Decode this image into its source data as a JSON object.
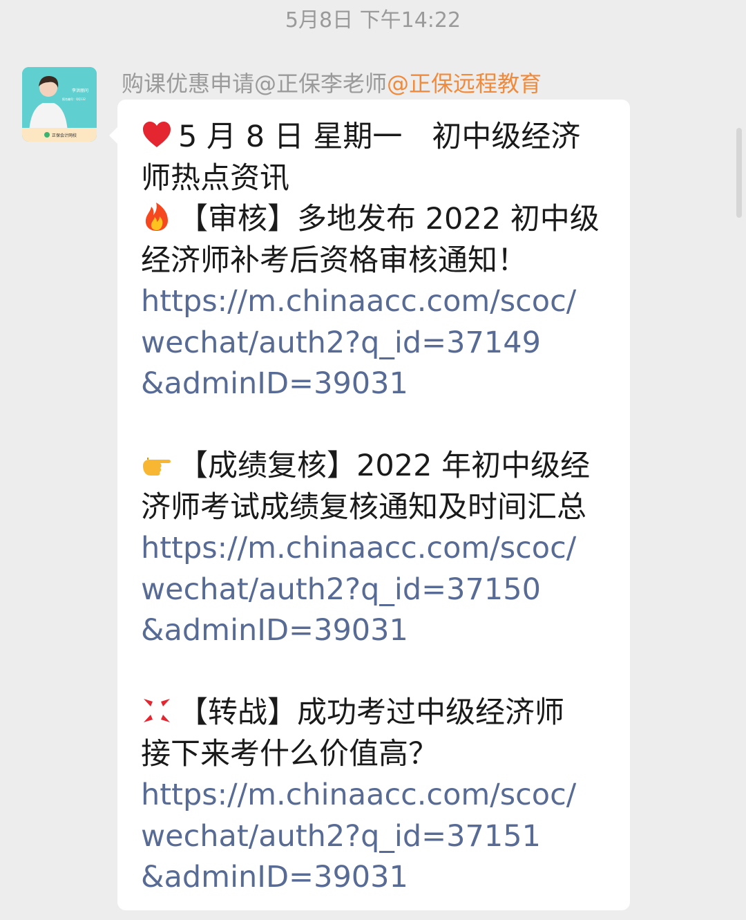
{
  "timestamp": "5月8日 下午14:22",
  "sender": {
    "name": "购课优惠申请@正保李老师",
    "org": "@正保远程教育"
  },
  "avatar": {
    "caption_name": "李洪丽问",
    "caption_id": "报名编号：QQ132",
    "brand": "正保会计网校"
  },
  "message": {
    "lines": [
      {
        "emoji": "heart-icon",
        "text": "5 月 8 日 星期一　初中级经济",
        "link": false
      },
      {
        "emoji": "",
        "text": "师热点资讯",
        "link": false
      },
      {
        "emoji": "fire-icon",
        "text": "【审核】多地发布 2022 初中级",
        "link": false
      },
      {
        "emoji": "",
        "text": "经济师补考后资格审核通知！",
        "link": false
      },
      {
        "emoji": "",
        "text": "https://m.chinaacc.com/scoc/",
        "link": true
      },
      {
        "emoji": "",
        "text": "wechat/auth2?q_id=37149",
        "link": true
      },
      {
        "emoji": "",
        "text": "&adminID=39031",
        "link": true
      },
      {
        "emoji": "",
        "text": "",
        "link": false
      },
      {
        "emoji": "pointing-hand-icon",
        "text": "【成绩复核】2022 年初中级经",
        "link": false
      },
      {
        "emoji": "",
        "text": "济师考试成绩复核通知及时间汇总",
        "link": false
      },
      {
        "emoji": "",
        "text": "https://m.chinaacc.com/scoc/",
        "link": true
      },
      {
        "emoji": "",
        "text": "wechat/auth2?q_id=37150",
        "link": true
      },
      {
        "emoji": "",
        "text": "&adminID=39031",
        "link": true
      },
      {
        "emoji": "",
        "text": "",
        "link": false
      },
      {
        "emoji": "anger-icon",
        "text": "【转战】成功考过中级经济师",
        "link": false
      },
      {
        "emoji": "",
        "text": "接下来考什么价值高？",
        "link": false
      },
      {
        "emoji": "",
        "text": "https://m.chinaacc.com/scoc/",
        "link": true
      },
      {
        "emoji": "",
        "text": "wechat/auth2?q_id=37151",
        "link": true
      },
      {
        "emoji": "",
        "text": "&adminID=39031",
        "link": true
      }
    ]
  },
  "colors": {
    "link": "#576b95",
    "org": "#f08a3c",
    "background": "#ededed"
  }
}
